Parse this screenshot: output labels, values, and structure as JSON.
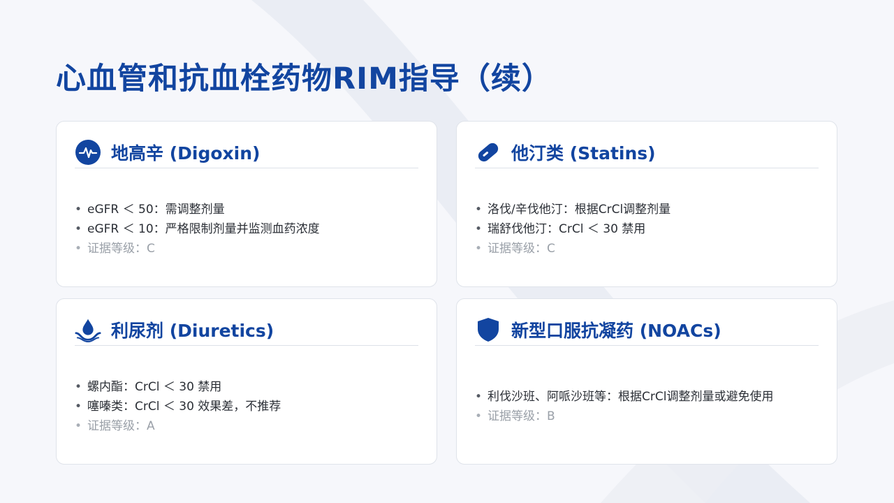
{
  "page_title": "心血管和抗血栓药物RIM指导（续）",
  "colors": {
    "accent": "#1245a0",
    "text": "#2b2f36",
    "muted": "#9aa0a8",
    "card_border": "#dfe3ea"
  },
  "cards": [
    {
      "title": "地高辛 (Digoxin)",
      "icon": "heartbeat-icon",
      "bullets": [
        "eGFR ＜ 50：需调整剂量",
        "eGFR ＜ 10：严格限制剂量并监测血药浓度"
      ],
      "evidence": "证据等级：C"
    },
    {
      "title": "他汀类 (Statins)",
      "icon": "pill-icon",
      "bullets": [
        "洛伐/辛伐他汀：根据CrCl调整剂量",
        "瑞舒伐他汀：CrCl ＜ 30 禁用"
      ],
      "evidence": "证据等级：C"
    },
    {
      "title": "利尿剂 (Diuretics)",
      "icon": "water-drop-icon",
      "bullets": [
        "螺内酯：CrCl ＜ 30 禁用",
        "噻嗪类：CrCl ＜ 30 效果差，不推荐"
      ],
      "evidence": "证据等级：A"
    },
    {
      "title": "新型口服抗凝药 (NOACs)",
      "icon": "shield-icon",
      "bullets": [
        "利伐沙班、阿哌沙班等：根据CrCl调整剂量或避免使用"
      ],
      "evidence": "证据等级：B"
    }
  ]
}
